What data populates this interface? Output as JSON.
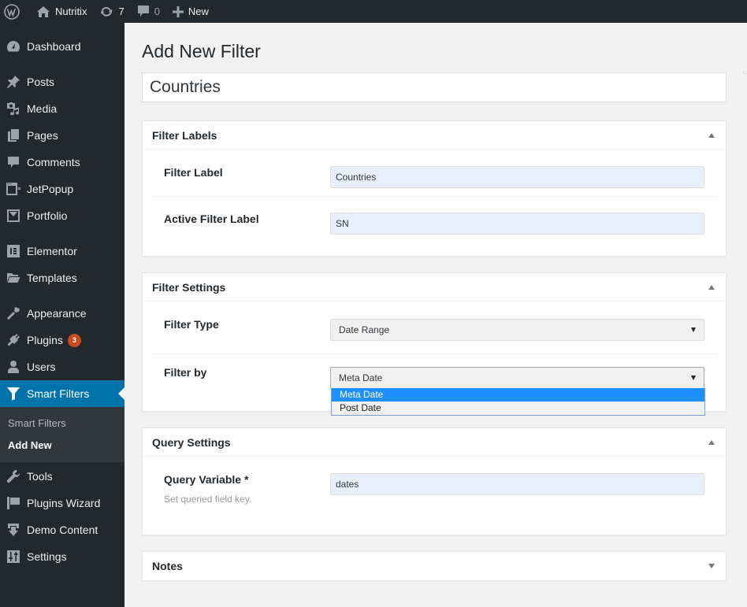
{
  "adminbar": {
    "wp_logo": "wordpress-logo-icon",
    "site_name": "Nutritix",
    "updates_count": "7",
    "comments_count": "0",
    "new_label": "New"
  },
  "sidebar": {
    "items": [
      {
        "label": "Dashboard",
        "icon": "dashboard-icon"
      },
      {
        "label": "Posts",
        "icon": "pin-icon"
      },
      {
        "label": "Media",
        "icon": "media-icon"
      },
      {
        "label": "Pages",
        "icon": "pages-icon"
      },
      {
        "label": "Comments",
        "icon": "comment-icon"
      },
      {
        "label": "JetPopup",
        "icon": "popup-icon"
      },
      {
        "label": "Portfolio",
        "icon": "portfolio-icon"
      },
      {
        "label": "Elementor",
        "icon": "elementor-icon"
      },
      {
        "label": "Templates",
        "icon": "folder-icon"
      },
      {
        "label": "Appearance",
        "icon": "brush-icon"
      },
      {
        "label": "Plugins",
        "icon": "plugin-icon",
        "badge": "3"
      },
      {
        "label": "Users",
        "icon": "user-icon"
      },
      {
        "label": "Smart Filters",
        "icon": "filter-icon",
        "active": true
      },
      {
        "label": "Tools",
        "icon": "wrench-icon"
      },
      {
        "label": "Plugins Wizard",
        "icon": "flag-icon"
      },
      {
        "label": "Demo Content",
        "icon": "download-icon"
      },
      {
        "label": "Settings",
        "icon": "sliders-icon"
      }
    ],
    "submenu": {
      "items": [
        {
          "label": "Smart Filters"
        },
        {
          "label": "Add New",
          "current": true
        }
      ]
    }
  },
  "main": {
    "page_title": "Add New Filter",
    "title_value": "Countries",
    "boxes": {
      "filter_labels": {
        "title": "Filter Labels",
        "fields": {
          "filter_label": {
            "label": "Filter Label",
            "value": "Countries"
          },
          "active_filter_label": {
            "label": "Active Filter Label",
            "value": "SN"
          }
        }
      },
      "filter_settings": {
        "title": "Filter Settings",
        "fields": {
          "filter_type": {
            "label": "Filter Type",
            "value": "Date Range"
          },
          "filter_by": {
            "label": "Filter by",
            "value": "Meta Date",
            "options": [
              "Meta Date",
              "Post Date"
            ],
            "highlighted": "Meta Date"
          }
        }
      },
      "query_settings": {
        "title": "Query Settings",
        "fields": {
          "query_variable": {
            "label": "Query Variable *",
            "description": "Set queried field key.",
            "value": "dates"
          }
        }
      },
      "notes": {
        "title": "Notes"
      }
    }
  },
  "colors": {
    "admin_dark": "#23282d",
    "submenu_bg": "#32373c",
    "active_blue": "#0073aa",
    "badge_orange": "#ca4a1f",
    "autofill_blue": "#e8f0fe",
    "option_highlight": "#1e90ff",
    "page_bg": "#f1f1f1"
  }
}
